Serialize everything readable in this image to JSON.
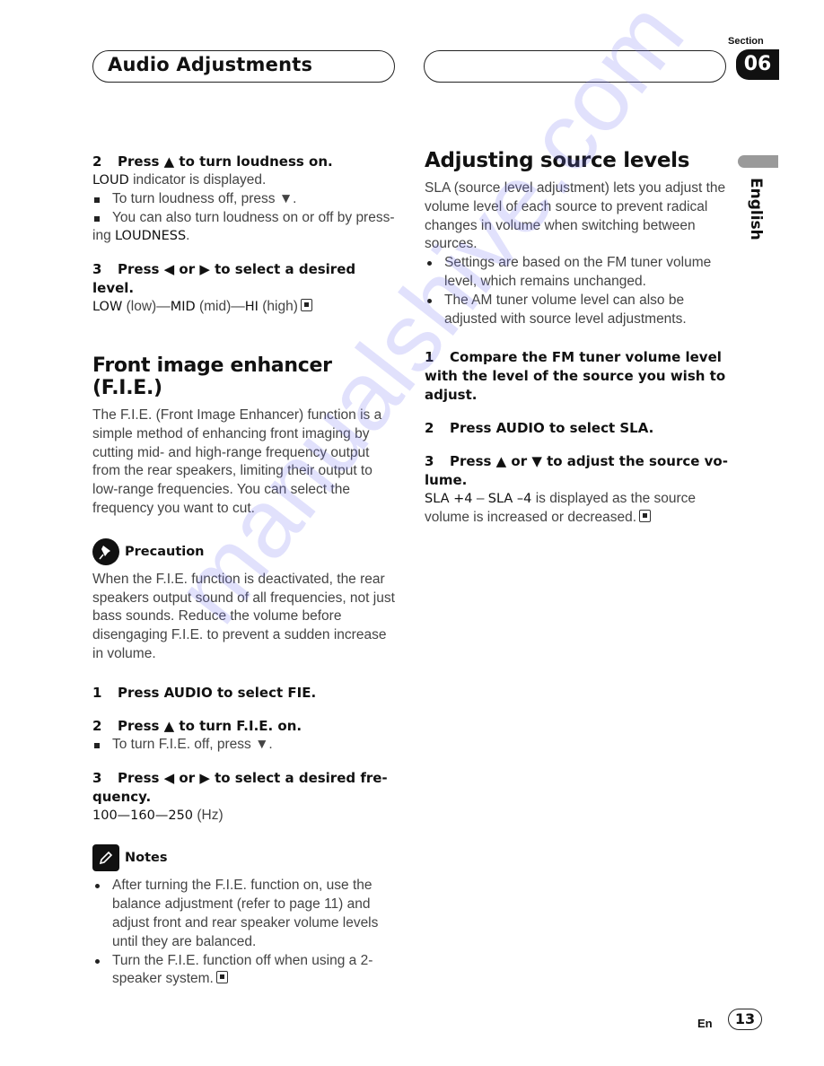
{
  "header": {
    "title": "Audio Adjustments",
    "section_label": "Section",
    "section_number": "06"
  },
  "side_tab": {
    "language": "English"
  },
  "left": {
    "loud_step2": {
      "num": "2",
      "title": "Press ▲ to turn loudness on.",
      "body_bold": "LOUD",
      "body_rest": " indicator is displayed.",
      "bullets": [
        "To turn loudness off, press ▼.",
        "You can also turn loudness on or off by press-"
      ],
      "bullet2_cont_pre": "ing ",
      "bullet2_cont_bold": "LOUDNESS",
      "bullet2_cont_post": "."
    },
    "loud_step3": {
      "num": "3",
      "title": "Press ◀ or ▶ to select a desired level.",
      "v1": "LOW",
      "v1n": " (low)—",
      "v2": "MID",
      "v2n": " (mid)—",
      "v3": "HI",
      "v3n": " (high)"
    },
    "fie": {
      "heading": "Front image enhancer (F.I.E.)",
      "intro": "The F.I.E. (Front Image Enhancer) function is a simple method of enhancing front imaging by cutting mid- and high-range frequency output from the rear speakers, limiting their output to low-range frequencies. You can select the frequency you want to cut.",
      "precaution_label": "Precaution",
      "precaution_text": "When the F.I.E. function is deactivated, the rear speakers output sound of all frequencies, not just bass sounds. Reduce the volume before disengaging F.I.E. to prevent a sudden increase in volume.",
      "step1": {
        "num": "1",
        "title": "Press AUDIO to select FIE."
      },
      "step2": {
        "num": "2",
        "title": "Press ▲ to turn F.I.E. on.",
        "bullet": "To turn F.I.E. off, press ▼."
      },
      "step3": {
        "num": "3",
        "title": "Press ◀ or ▶ to select a desired fre-",
        "title_cont": "quency.",
        "values_bold": "100—160—250",
        "values_unit": " (Hz)"
      },
      "notes_label": "Notes",
      "notes": [
        "After turning the F.I.E. function on, use the balance adjustment (refer to page 11) and adjust front and rear speaker volume levels until they are balanced.",
        "Turn the F.I.E. function off when using a 2-speaker system."
      ]
    }
  },
  "right": {
    "heading": "Adjusting source levels",
    "intro": "SLA (source level adjustment) lets you adjust the volume level of each source to prevent radical changes in volume when switching between sources.",
    "bullets": [
      "Settings are based on the FM tuner volume level, which remains unchanged.",
      "The AM tuner volume level can also be adjusted with source level adjustments."
    ],
    "step1": {
      "num": "1",
      "title": "Compare the FM tuner volume level with the level of the source you wish to adjust."
    },
    "step2": {
      "num": "2",
      "title": "Press AUDIO to select SLA."
    },
    "step3": {
      "num": "3",
      "title": "Press ▲ or ▼ to adjust the source vo-",
      "title_cont": "lume.",
      "range_a": "SLA +4",
      "range_sep": " – ",
      "range_b": "SLA –4",
      "range_text": " is displayed as the source volume is increased or decreased."
    }
  },
  "footer": {
    "lang_code": "En",
    "page_number": "13"
  },
  "watermark": "manualshive.com"
}
